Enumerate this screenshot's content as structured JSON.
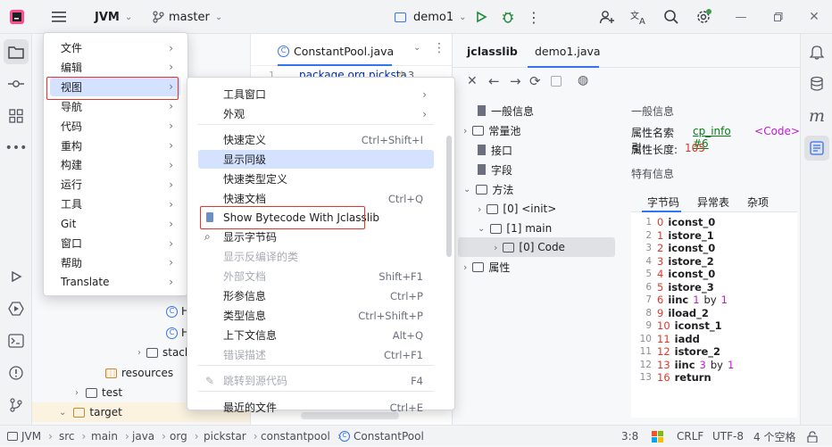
{
  "topbar": {
    "project": "JVM",
    "branch": "master",
    "run_config": "demo1"
  },
  "project_tree": {
    "resources": "resources",
    "test": "test",
    "target": "target",
    "stack_partial": "stacl",
    "h1": "H",
    "h2": "H"
  },
  "editor": {
    "tab_label": "ConstantPool.java",
    "line_no": "1",
    "code_snippet": "package org.picksta",
    "warn_count": "3"
  },
  "main_menu": {
    "items": [
      {
        "label": "文件"
      },
      {
        "label": "编辑"
      },
      {
        "label": "视图"
      },
      {
        "label": "导航"
      },
      {
        "label": "代码"
      },
      {
        "label": "重构"
      },
      {
        "label": "构建"
      },
      {
        "label": "运行"
      },
      {
        "label": "工具"
      },
      {
        "label": "Git"
      },
      {
        "label": "窗口"
      },
      {
        "label": "帮助"
      },
      {
        "label": "Translate"
      }
    ]
  },
  "view_menu": {
    "items": [
      {
        "label": "工具窗口",
        "shortcut": ""
      },
      {
        "label": "外观",
        "shortcut": ""
      },
      {
        "label": "快速定义",
        "shortcut": "Ctrl+Shift+I"
      },
      {
        "label": "显示同级",
        "shortcut": ""
      },
      {
        "label": "快速类型定义",
        "shortcut": ""
      },
      {
        "label": "快速文档",
        "shortcut": "Ctrl+Q"
      },
      {
        "label": "Show Bytecode With Jclasslib",
        "shortcut": ""
      },
      {
        "label": "显示字节码",
        "shortcut": ""
      },
      {
        "label": "显示反编译的类",
        "shortcut": ""
      },
      {
        "label": "外部文档",
        "shortcut": "Shift+F1"
      },
      {
        "label": "形参信息",
        "shortcut": "Ctrl+P"
      },
      {
        "label": "类型信息",
        "shortcut": "Ctrl+Shift+P"
      },
      {
        "label": "上下文信息",
        "shortcut": "Alt+Q"
      },
      {
        "label": "错误描述",
        "shortcut": "Ctrl+F1"
      },
      {
        "label": "跳转到源代码",
        "shortcut": "F4"
      },
      {
        "label": "最近的文件",
        "shortcut": "Ctrl+E"
      }
    ]
  },
  "jclasslib": {
    "tabs": [
      "jclasslib",
      "demo1.java"
    ],
    "tree": {
      "general": "一般信息",
      "constant_pool": "常量池",
      "interfaces": "接口",
      "fields": "字段",
      "methods": "方法",
      "init": "[0] <init>",
      "main": "[1] main",
      "code": "[0] Code",
      "attributes": "属性"
    },
    "general_header": "一般信息",
    "name_index_label": "属性名索引:",
    "name_index_link": "cp_info #6",
    "name_index_value": "<Code>",
    "length_label": "属性长度:",
    "length_value": "105",
    "specific_header": "特有信息",
    "subtabs": [
      "字节码",
      "异常表",
      "杂项"
    ],
    "bytecode": [
      {
        "ln": "1",
        "off": "0",
        "op": "iconst_0",
        "arg": "",
        "by": "",
        "arg2": ""
      },
      {
        "ln": "2",
        "off": "1",
        "op": "istore_1",
        "arg": "",
        "by": "",
        "arg2": ""
      },
      {
        "ln": "3",
        "off": "2",
        "op": "iconst_0",
        "arg": "",
        "by": "",
        "arg2": ""
      },
      {
        "ln": "4",
        "off": "3",
        "op": "istore_2",
        "arg": "",
        "by": "",
        "arg2": ""
      },
      {
        "ln": "5",
        "off": "4",
        "op": "iconst_0",
        "arg": "",
        "by": "",
        "arg2": ""
      },
      {
        "ln": "6",
        "off": "5",
        "op": "istore_3",
        "arg": "",
        "by": "",
        "arg2": ""
      },
      {
        "ln": "7",
        "off": "6",
        "op": "iinc",
        "arg": "1",
        "by": "by",
        "arg2": "1"
      },
      {
        "ln": "8",
        "off": "9",
        "op": "iload_2",
        "arg": "",
        "by": "",
        "arg2": ""
      },
      {
        "ln": "9",
        "off": "10",
        "op": "iconst_1",
        "arg": "",
        "by": "",
        "arg2": ""
      },
      {
        "ln": "10",
        "off": "11",
        "op": "iadd",
        "arg": "",
        "by": "",
        "arg2": ""
      },
      {
        "ln": "11",
        "off": "12",
        "op": "istore_2",
        "arg": "",
        "by": "",
        "arg2": ""
      },
      {
        "ln": "12",
        "off": "13",
        "op": "iinc",
        "arg": "3",
        "by": "by",
        "arg2": "1"
      },
      {
        "ln": "13",
        "off": "16",
        "op": "return",
        "arg": "",
        "by": "",
        "arg2": ""
      }
    ]
  },
  "statusbar": {
    "breadcrumb": [
      "JVM",
      "src",
      "main",
      "java",
      "org",
      "pickstar",
      "constantpool",
      "ConstantPool"
    ],
    "position": "3:8",
    "line_sep": "CRLF",
    "encoding": "UTF-8",
    "indent": "4 个空格"
  },
  "colors": {
    "highlight_blue": "#d4e2ff",
    "red_outline": "#e0362c",
    "num_red": "#e0362c",
    "magenta": "#c11ad6",
    "link_green": "#067d17"
  }
}
